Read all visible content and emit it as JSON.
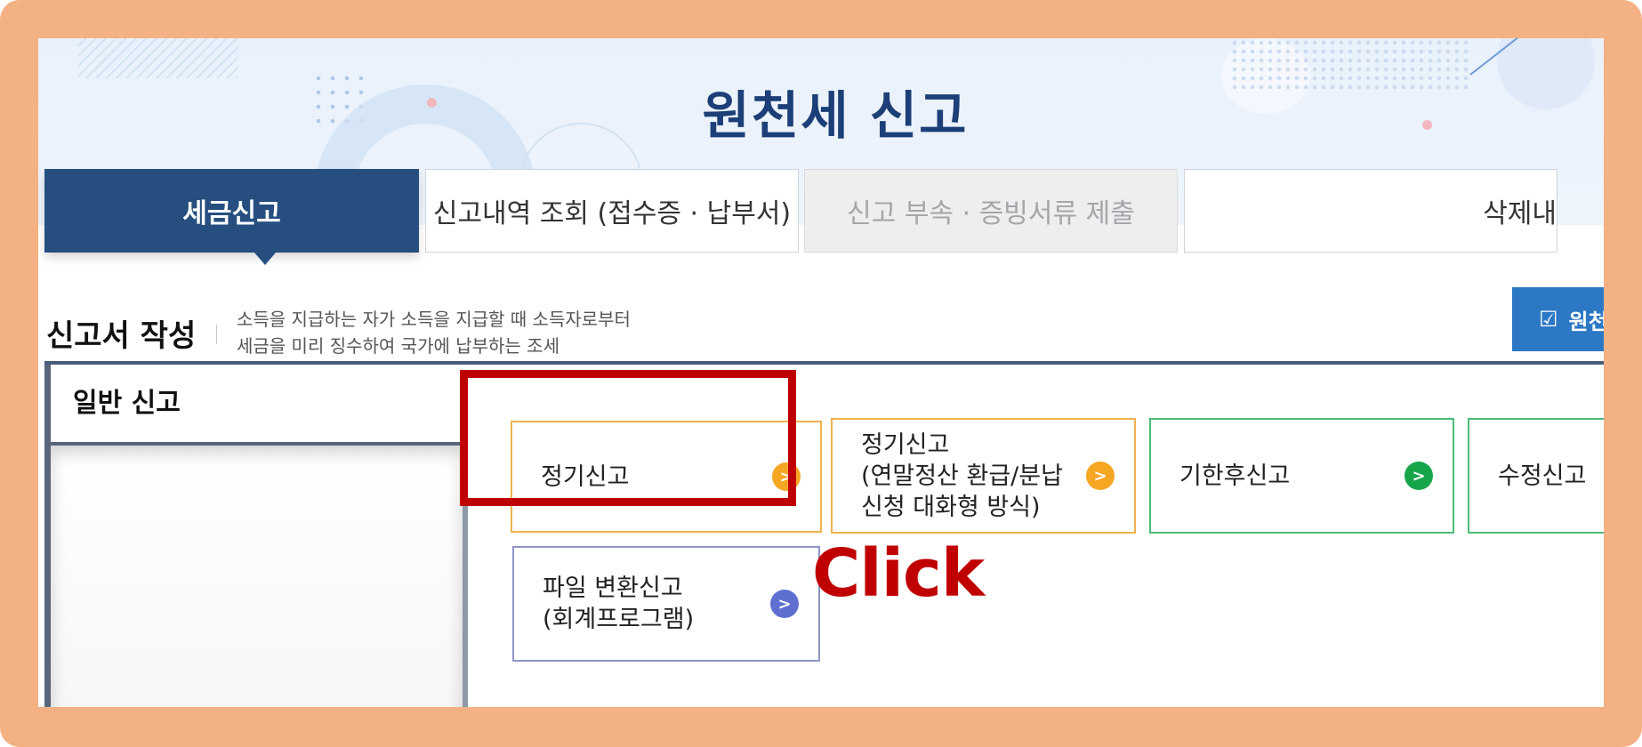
{
  "page": {
    "title": "원천세 신고"
  },
  "tabs": [
    {
      "label": "세금신고",
      "state": "active"
    },
    {
      "label": "신고내역 조회 (접수증 · 납부서)",
      "state": "normal"
    },
    {
      "label": "신고 부속 · 증빙서류 제출",
      "state": "disabled"
    },
    {
      "label": "삭제내",
      "state": "normal"
    }
  ],
  "section": {
    "title": "신고서 작성",
    "desc_line1": "소득을 지급하는 자가 소득을 지급할 때 소득자로부터",
    "desc_line2": "세금을 미리 징수하여 국가에 납부하는 조세",
    "action_button": "원천"
  },
  "sidebar": {
    "label": "일반 신고"
  },
  "cards": [
    {
      "label": "정기신고",
      "color": "#f5a623"
    },
    {
      "label_lines": [
        "정기신고",
        "(연말정산 환급/분납",
        "신청 대화형 방식)"
      ],
      "color": "#f5a623"
    },
    {
      "label": "기한후신고",
      "color": "#17a54a"
    },
    {
      "label": "수정신고",
      "color": "#17a54a"
    },
    {
      "label_lines": [
        "파일 변환신고",
        "(회계프로그램)"
      ],
      "color": "#5f6fd0"
    }
  ],
  "annotation": {
    "text": "Click",
    "color": "#c00000"
  },
  "colors": {
    "frame": "#f4b183",
    "tab_active": "#264f80",
    "title": "#1c3f77"
  }
}
